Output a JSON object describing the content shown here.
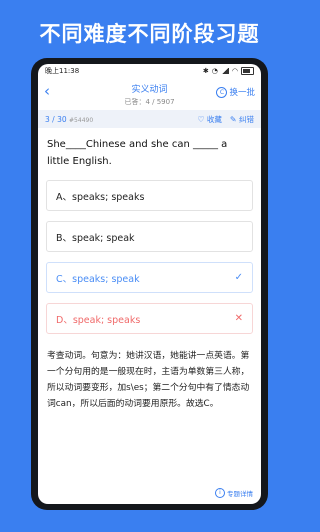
{
  "banner": {
    "title": "不同难度不同阶段习题"
  },
  "statusbar": {
    "time": "晚上11:38"
  },
  "header": {
    "back_icon": "chevron-left-icon",
    "title": "实义动词",
    "subtitle": "已答：4 / 5907",
    "switch_label": "换一批",
    "switch_icon": "refresh-circle-icon"
  },
  "progress": {
    "current": "3",
    "total": "/ 30",
    "qid": "#54490",
    "favorite_label": "收藏",
    "favorite_icon": "heart-icon",
    "correct_label": "纠错",
    "correct_icon": "edit-icon"
  },
  "question": {
    "text": "She____Chinese and she can _____ a little English."
  },
  "options": [
    {
      "label": "A、speaks; speaks",
      "state": "normal",
      "mark": ""
    },
    {
      "label": "B、speak; speak",
      "state": "normal",
      "mark": ""
    },
    {
      "label": "C、speaks; speak",
      "state": "correct",
      "mark": "✓"
    },
    {
      "label": "D、speak; speaks",
      "state": "wrong",
      "mark": "✕"
    }
  ],
  "explanation": {
    "text": "考查动词。句意为：她讲汉语，她能讲一点英语。第一个分句用的是一般现在时，主语为单数第三人称，所以动词要变形，加s\\es；第二个分句中有了情态动词can，所以后面的动词要用原形。故选C。"
  },
  "footer": {
    "label": "专题详情",
    "icon": "info-circle-icon"
  },
  "colors": {
    "accent": "#3a7ff0",
    "correct": "#4a8df5",
    "wrong": "#f06a6a"
  }
}
